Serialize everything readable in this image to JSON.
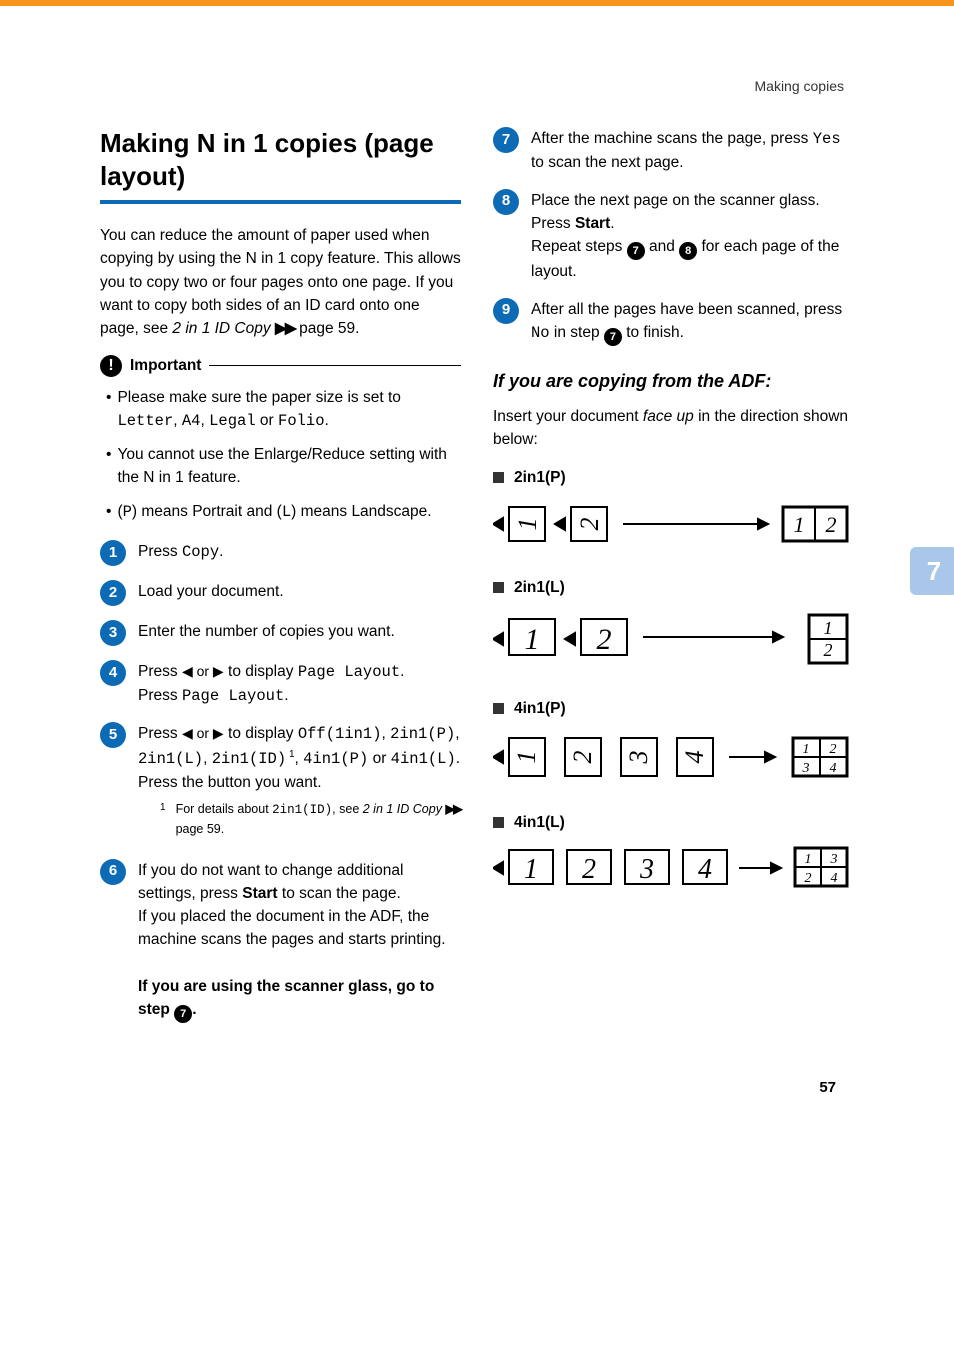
{
  "breadcrumb": "Making copies",
  "page_number": "57",
  "side_tab": "7",
  "title": "Making N in 1 copies (page layout)",
  "intro": "You can reduce the amount of paper used when copying by using the N in 1 copy feature. This allows you to copy two or four pages onto one page. If you want to copy both sides of an ID card onto one page, see ",
  "intro_xref": "2 in 1 ID Copy",
  "intro_tail": " page 59.",
  "important_label": "Important",
  "imp1_pre": "Please make sure the paper size is set to ",
  "imp1_m1": "Letter",
  "imp1_s1": ", ",
  "imp1_m2": "A4",
  "imp1_s2": ", ",
  "imp1_m3": "Legal",
  "imp1_s3": " or ",
  "imp1_m4": "Folio",
  "imp1_s4": ".",
  "imp2": "You cannot use the Enlarge/Reduce setting with the N in 1 feature.",
  "imp3_pre": "(",
  "imp3_p": "P",
  "imp3_mid": ") means Portrait and (",
  "imp3_l": "L",
  "imp3_tail": ") means Landscape.",
  "s1_pre": "Press ",
  "s1_m": "Copy",
  "s1_post": ".",
  "s2": "Load your document.",
  "s3": "Enter the number of copies you want.",
  "s4_pre": "Press ",
  "s4_mid": " to display ",
  "s4_m1": "Page Layout",
  "s4_post": ".",
  "s4_line2_pre": "Press ",
  "s4_line2_m": "Page Layout",
  "s4_line2_post": ".",
  "s5_pre": "Press ",
  "s5_mid": " to display ",
  "s5_m1": "Off(1in1)",
  "s5_s1": ", ",
  "s5_m2": "2in1(P)",
  "s5_s2": ", ",
  "s5_m3": "2in1(L)",
  "s5_s3": ", ",
  "s5_m4": "2in1(ID)",
  "s5_sup": " 1",
  "s5_s4": ", ",
  "s5_m5": "4in1(P)",
  "s5_s5": " or ",
  "s5_m6": "4in1(L)",
  "s5_s6": ".",
  "s5_line3": "Press the button you want.",
  "fn_num": "1",
  "fn_pre": "For details about ",
  "fn_m": "2in1(ID)",
  "fn_mid": ", see ",
  "fn_xref": "2 in 1 ID Copy",
  "fn_tail": " page 59.",
  "s6_l1": "If you do not want to change additional settings, press ",
  "s6_start": "Start",
  "s6_l1b": " to scan the page.",
  "s6_l2": "If you placed the document in the ADF, the machine scans the pages and starts printing.",
  "s6_l3a": "If you are using the scanner glass, go to step ",
  "s6_l3b": ".",
  "s7_a": "After the machine scans the page, press ",
  "s7_m": "Yes",
  "s7_b": " to scan the next page.",
  "s8_l1": "Place the next page on the scanner glass.",
  "s8_l2a": "Press ",
  "s8_start": "Start",
  "s8_l2b": ".",
  "s8_l3a": "Repeat steps ",
  "s8_l3b": " and ",
  "s8_l3c": " for each page of the layout.",
  "s9_a": "After all the pages have been scanned, press ",
  "s9_m": "No",
  "s9_b": " in step ",
  "s9_c": " to finish.",
  "adf_heading": "If you are copying from the ADF:",
  "adf_text_a": "Insert your document ",
  "adf_text_i": "face up",
  "adf_text_b": " in the direction shown below:",
  "d1": "2in1(P)",
  "d2": "2in1(L)",
  "d3": "4in1(P)",
  "d4": "4in1(L)",
  "lor": "◀ or ▶"
}
